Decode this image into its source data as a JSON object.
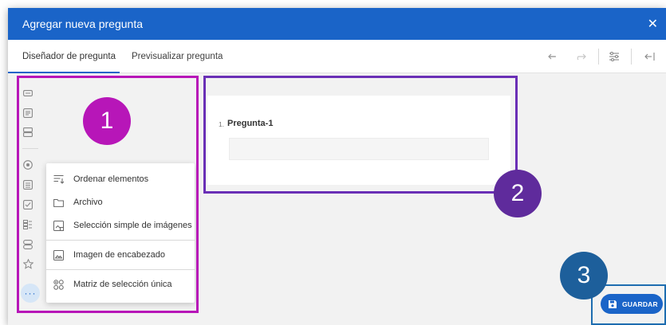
{
  "dialog": {
    "title": "Agregar nueva pregunta",
    "close_icon": "close-icon"
  },
  "tabs": [
    {
      "label": "Diseñador de pregunta",
      "active": true
    },
    {
      "label": "Previsualizar pregunta",
      "active": false
    }
  ],
  "toolbar": {
    "icons": [
      "undo-icon",
      "redo-icon",
      "settings-sliders-icon",
      "collapse-panel-icon"
    ]
  },
  "sidebar": {
    "icons": [
      "text-field-icon",
      "comment-icon",
      "multiple-text-icon",
      "radiogroup-icon",
      "dropdown-icon",
      "checkbox-icon",
      "ranking-icon",
      "matrix-icon",
      "star-rating-icon"
    ],
    "more_icon": "more-dots-icon",
    "more_label": "···"
  },
  "popup": {
    "items": [
      {
        "label": "Ordenar elementos",
        "icon": "ranking-icon"
      },
      {
        "label": "Archivo",
        "icon": "folder-icon"
      },
      {
        "label": "Selección simple de imágenes",
        "icon": "image-picker-icon"
      },
      {
        "label": "Imagen de encabezado",
        "icon": "image-icon"
      },
      {
        "label": "Matriz de selección única",
        "icon": "matrix-single-icon"
      }
    ]
  },
  "question": {
    "number": "1.",
    "title": "Pregunta-1"
  },
  "save": {
    "label": "GUARDAR",
    "icon": "save-icon"
  },
  "annotations": {
    "badges": [
      "1",
      "2",
      "3"
    ],
    "colors": {
      "badge1": "#b716b8",
      "box1": "#b716b8",
      "badge2": "#5f2b9c",
      "box2": "#6a2fb6",
      "badge3": "#1d5f9b",
      "box3": "#1d6db0"
    }
  },
  "colors": {
    "accent": "#1a64c8",
    "background": "#f2f2f2"
  }
}
